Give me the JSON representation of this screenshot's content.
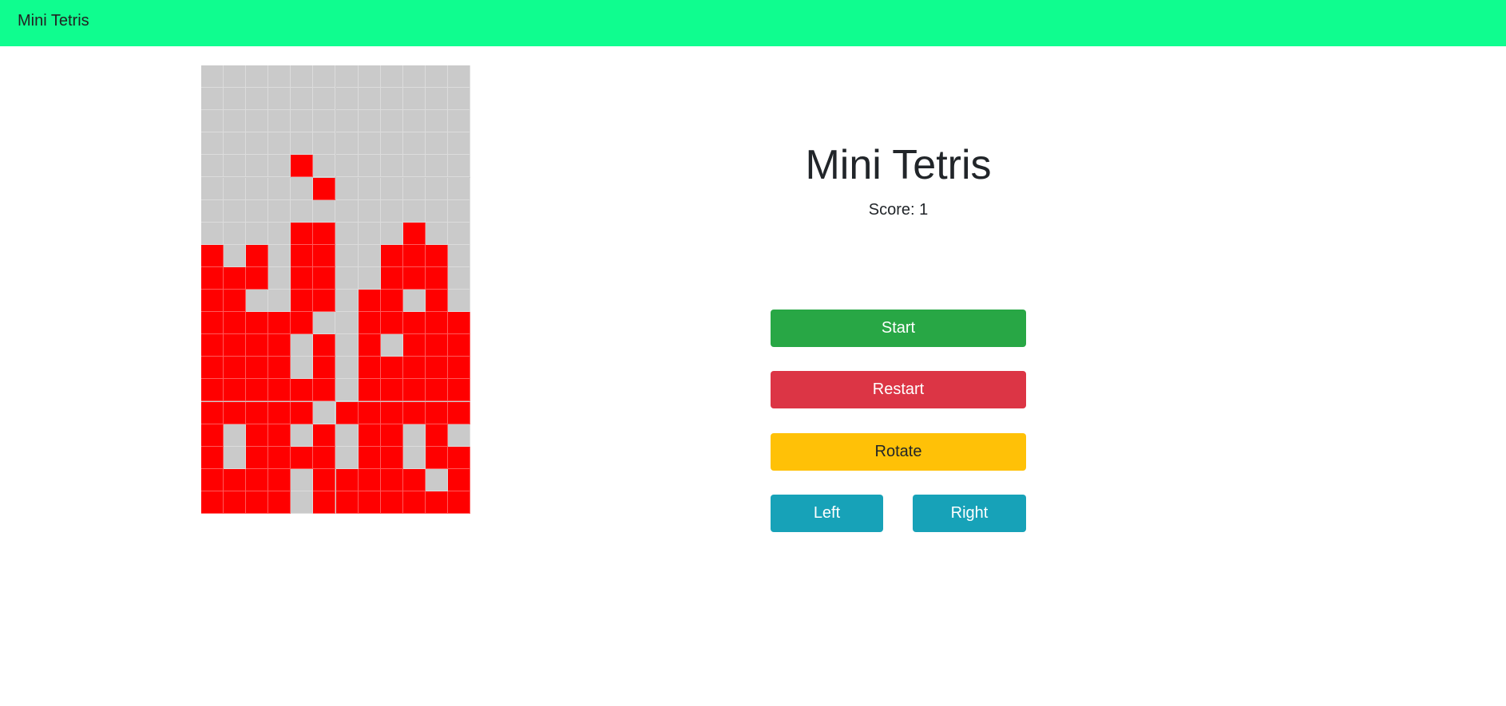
{
  "navbar": {
    "brand": "Mini Tetris"
  },
  "game": {
    "title": "Mini Tetris",
    "score_text": "Score: 1",
    "score": 1,
    "filled_color": "#ff0000",
    "empty_color": "#cacaca",
    "columns": 12,
    "rows": 20,
    "grid": [
      "............",
      "............",
      "............",
      "............",
      "....#.......",
      ".....#......",
      "............",
      "....##...#..",
      "#.#.##..###.",
      "###.##..###.",
      "##..##.##.#.",
      "#####..#####",
      "####.#.#.###",
      "####.#.#####",
      "######.#####",
      "#####.######",
      "#.##.#.##.#.",
      "#.####.##.##",
      "####.#####.#",
      "####.#######"
    ]
  },
  "controls": {
    "start": "Start",
    "restart": "Restart",
    "rotate": "Rotate",
    "left": "Left",
    "right": "Right"
  }
}
